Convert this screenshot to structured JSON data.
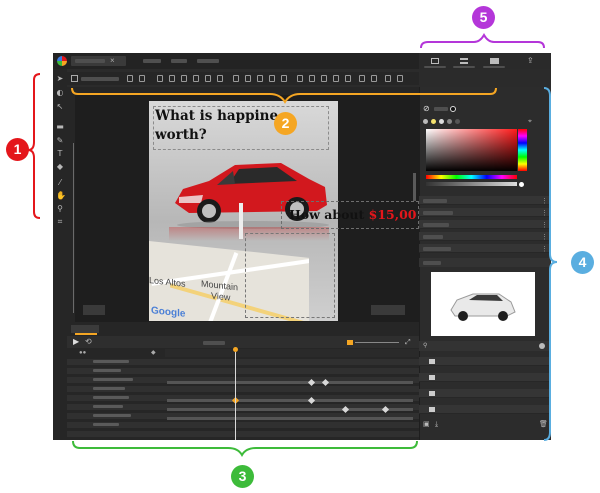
{
  "stage": {
    "headline": "What is happine",
    "headline_line2": "worth?",
    "price_prefix": "How about ",
    "price_value": "$15,00",
    "map_labels": [
      "Los Altos",
      "Mountain",
      "View",
      "Google"
    ]
  },
  "callouts": [
    {
      "number": "1",
      "color": "#e4161b"
    },
    {
      "number": "2",
      "color": "#f5a623"
    },
    {
      "number": "3",
      "color": "#3dbb3a"
    },
    {
      "number": "4",
      "color": "#5aaee0"
    },
    {
      "number": "5",
      "color": "#b436d9"
    }
  ],
  "colors": {
    "accent": "#f5a623",
    "app_bg": "#2b2b2b",
    "price_red": "#e4161b"
  }
}
